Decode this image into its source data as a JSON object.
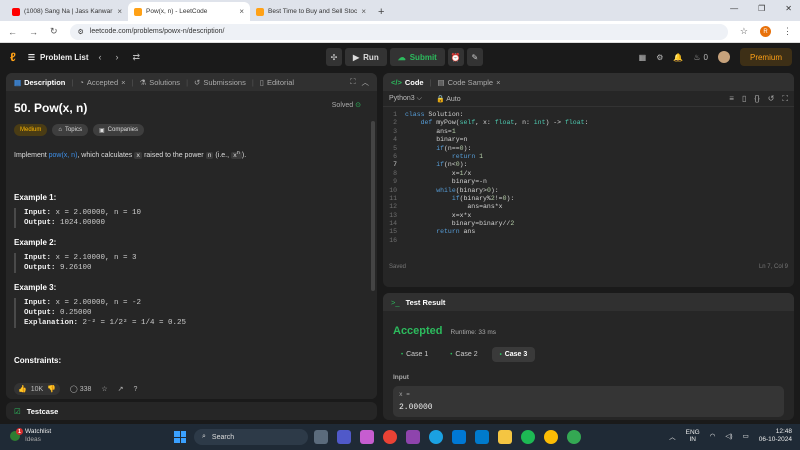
{
  "browser": {
    "tabs": [
      {
        "title": "(1008) Sang Na | Jass Kanwar | ",
        "favicon_color": "#ff0000",
        "active": false
      },
      {
        "title": "Pow(x, n) - LeetCode",
        "favicon_color": "#ffa116",
        "active": true
      },
      {
        "title": "Best Time to Buy and Sell Stock",
        "favicon_color": "#ffa116",
        "active": false
      }
    ],
    "new_tab": "+",
    "close": "×",
    "url": "leetcode.com/problems/powx-n/description/",
    "profile_initial": "R"
  },
  "lc_nav": {
    "problem_list": "Problem List",
    "run": "Run",
    "submit": "Submit",
    "streak": "0",
    "premium": "Premium"
  },
  "description": {
    "tabs": [
      "Description",
      "Accepted",
      "Solutions",
      "Submissions",
      "Editorial"
    ],
    "title": "50. Pow(x, n)",
    "solved": "Solved",
    "tags": [
      "Medium",
      "Topics",
      "Companies"
    ],
    "text_pre": "Implement ",
    "text_link": "pow(x, n)",
    "text_mid": ", which calculates ",
    "text_x": "x",
    "text_mid2": " raised to the power ",
    "text_n": "n",
    "text_end": " (i.e., ",
    "text_xn": "x",
    "text_sup": "n",
    "text_close": ").",
    "examples": [
      {
        "title": "Example 1:",
        "input": "x = 2.00000, n = 10",
        "output": "1024.00000"
      },
      {
        "title": "Example 2:",
        "input": "x = 2.10000, n = 3",
        "output": "9.26100"
      },
      {
        "title": "Example 3:",
        "input": "x = 2.00000, n = -2",
        "output": "0.25000",
        "explanation": "2⁻² = 1/2² = 1/4 = 0.25"
      }
    ],
    "input_label": "Input:",
    "output_label": "Output:",
    "explanation_label": "Explanation:",
    "constraints": "Constraints:",
    "likes": "10K",
    "comments": "338"
  },
  "testcase": {
    "label": "Testcase"
  },
  "code": {
    "tabs": [
      "Code",
      "Code Sample"
    ],
    "language": "Python3",
    "mode": "Auto",
    "lines": [
      "class Solution:",
      "    def myPow(self, x: float, n: int) -> float:",
      "        ans=1",
      "        binary=n",
      "        if(n==0):",
      "            return 1",
      "        if(n<0):",
      "            x=1/x",
      "            binary=-n",
      "        while(binary>0):",
      "            if(binary%2!=0):",
      "                ans=ans*x",
      "            x=x*x",
      "            binary=binary//2",
      "        return ans",
      ""
    ],
    "current_line": 7,
    "status": "Saved",
    "cursor": "Ln 7, Col 9"
  },
  "result": {
    "title": "Test Result",
    "verdict": "Accepted",
    "runtime": "Runtime: 33 ms",
    "cases": [
      "Case 1",
      "Case 2",
      "Case 3"
    ],
    "active_case": 2,
    "input_label": "Input",
    "var": "x =",
    "value": "2.00000"
  },
  "taskbar": {
    "weather_title": "Watchlist",
    "weather_sub": "Ideas",
    "badge": "1",
    "search": "Search",
    "lang1": "ENG",
    "lang2": "IN",
    "time": "12:48",
    "date": "06-10-2024"
  }
}
